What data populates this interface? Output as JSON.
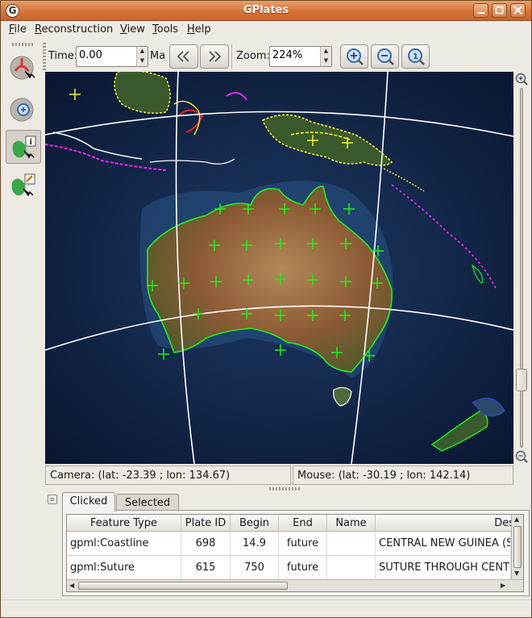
{
  "window": {
    "title": "GPlates",
    "app_icon": "G",
    "buttons": [
      "minimize",
      "maximize",
      "close"
    ]
  },
  "menu": [
    {
      "label": "File",
      "mnemonic": "F",
      "rest": "ile"
    },
    {
      "label": "Reconstruction",
      "mnemonic": "R",
      "rest": "econstruction"
    },
    {
      "label": "View",
      "mnemonic": "V",
      "rest": "iew"
    },
    {
      "label": "Tools",
      "mnemonic": "T",
      "rest": "ools"
    },
    {
      "label": "Help",
      "mnemonic": "H",
      "rest": "elp"
    }
  ],
  "tools": [
    {
      "icon": "drag-globe-icon",
      "active": false
    },
    {
      "icon": "zoom-globe-icon",
      "active": false
    },
    {
      "icon": "query-feature-icon",
      "active": true
    },
    {
      "icon": "edit-feature-icon",
      "active": false
    }
  ],
  "toolbar": {
    "time_label": "Time:",
    "time_value": "0.00",
    "time_unit": "Ma",
    "zoom_label": "Zoom:",
    "zoom_value": "224%"
  },
  "status": {
    "camera": "Camera: (lat: -23.39 ; lon: 134.67)",
    "mouse": "Mouse:  (lat: -30.19 ; lon: 142.14)"
  },
  "tabs": [
    {
      "label": "Clicked",
      "active": true
    },
    {
      "label": "Selected",
      "active": false
    }
  ],
  "table": {
    "columns": [
      "Feature Type",
      "Plate ID",
      "Begin",
      "End",
      "Name",
      "Des"
    ],
    "rows": [
      [
        "gpml:Coastline",
        "698",
        "14.9",
        "future",
        "",
        "CENTRAL NEW GUINEA (SEP"
      ],
      [
        "gpml:Suture",
        "615",
        "750",
        "future",
        "",
        "SUTURE THROUGH CENTRA"
      ]
    ]
  },
  "colors": {
    "title_bar": "#d8763c",
    "coastline": "#22ee22",
    "yellow_features": "#ffee33",
    "magenta_features": "#ee22ee",
    "red_features": "#ee2222",
    "graticule": "#ffffff"
  }
}
